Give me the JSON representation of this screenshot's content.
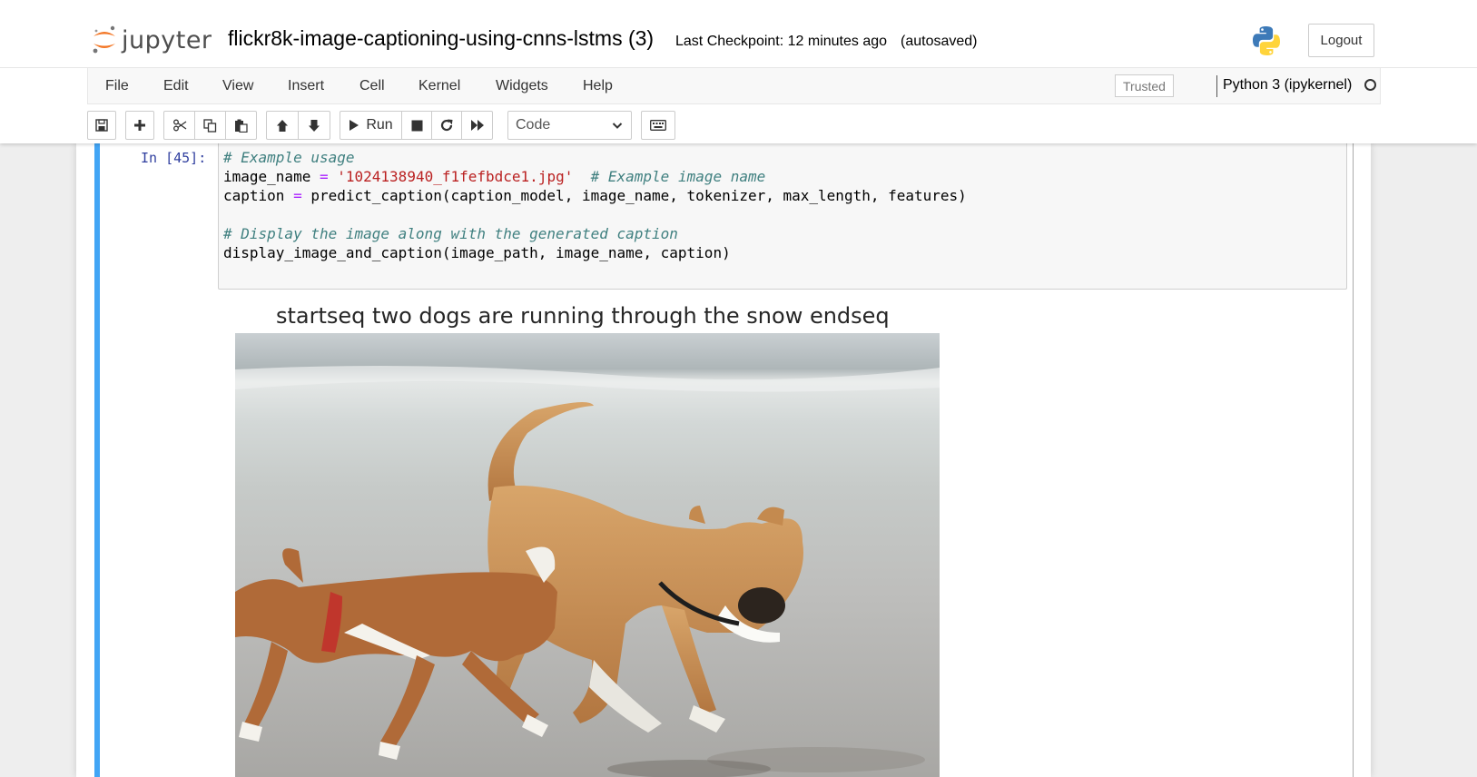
{
  "header": {
    "logo_text": "jupyter",
    "notebook_name": "flickr8k-image-captioning-using-cnns-lstms (3)",
    "checkpoint": "Last Checkpoint: 12 minutes ago",
    "autosave": "(autosaved)",
    "logout_label": "Logout"
  },
  "menu": {
    "items": [
      "File",
      "Edit",
      "View",
      "Insert",
      "Cell",
      "Kernel",
      "Widgets",
      "Help"
    ],
    "trusted_label": "Trusted",
    "kernel_name": "Python 3 (ipykernel)"
  },
  "toolbar": {
    "run_label": "Run",
    "cell_type": "Code"
  },
  "cell": {
    "prompt": "In [45]:",
    "lines": [
      "# Example usage",
      "image_name = '1024138940_f1fefbdce1.jpg'  # Example image name",
      "caption = predict_caption(caption_model, image_name, tokenizer, max_length, features)",
      "",
      "# Display the image along with the generated caption",
      "display_image_and_caption(image_path, image_name, caption)"
    ]
  },
  "output": {
    "title": "startseq two dogs are running through the snow endseq"
  },
  "colors": {
    "selected_cell_bar": "#42a5f5",
    "prompt_blue": "#303f9f",
    "jupyter_orange": "#f37726"
  }
}
